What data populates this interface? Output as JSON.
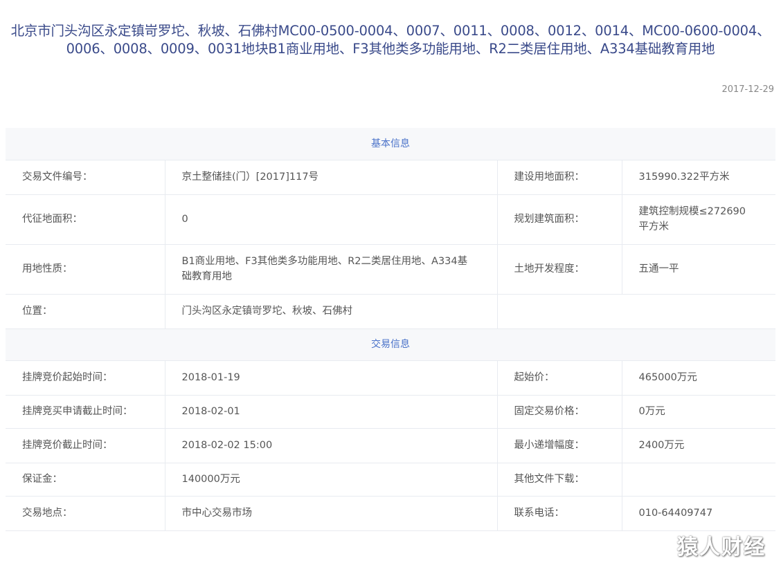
{
  "title": "北京市门头沟区永定镇岢罗坨、秋坡、石佛村MC00-0500-0004、0007、0011、0008、0012、0014、MC00-0600-0004、0006、0008、0009、0031地块B1商业用地、F3其他类多功能用地、R2二类居住用地、A334基础教育用地",
  "date": "2017-12-29",
  "basic": {
    "header": "基本信息",
    "rows": [
      {
        "l1": "交易文件编号：",
        "v1": "京土整储挂(门）[2017]117号",
        "l2": "建设用地面积：",
        "v2": "315990.322平方米"
      },
      {
        "l1": "代征地面积：",
        "v1": "0",
        "l2": "规划建筑面积：",
        "v2": "建筑控制规模≤272690平方米"
      },
      {
        "l1": "用地性质：",
        "v1": "B1商业用地、F3其他类多功能用地、R2二类居住用地、A334基础教育用地",
        "l2": "土地开发程度：",
        "v2": "五通一平"
      },
      {
        "l1": "位置：",
        "v1": "门头沟区永定镇岢罗坨、秋坡、石佛村",
        "l2": "",
        "v2": ""
      }
    ]
  },
  "trade": {
    "header": "交易信息",
    "rows": [
      {
        "l1": "挂牌竞价起始时间：",
        "v1": "2018-01-19",
        "l2": "起始价：",
        "v2": "465000万元"
      },
      {
        "l1": "挂牌竞买申请截止时间：",
        "v1": "2018-02-01",
        "l2": "固定交易价格：",
        "v2": "0万元"
      },
      {
        "l1": "挂牌竞价截止时间：",
        "v1": "2018-02-02 15:00",
        "l2": "最小递增幅度：",
        "v2": "2400万元"
      },
      {
        "l1": "保证金：",
        "v1": "140000万元",
        "l2": "其他文件下载：",
        "v2": ""
      },
      {
        "l1": "交易地点：",
        "v1": "市中心交易市场",
        "l2": "联系电话：",
        "v2": "010-64409747"
      }
    ]
  },
  "watermark": "猿人财经"
}
